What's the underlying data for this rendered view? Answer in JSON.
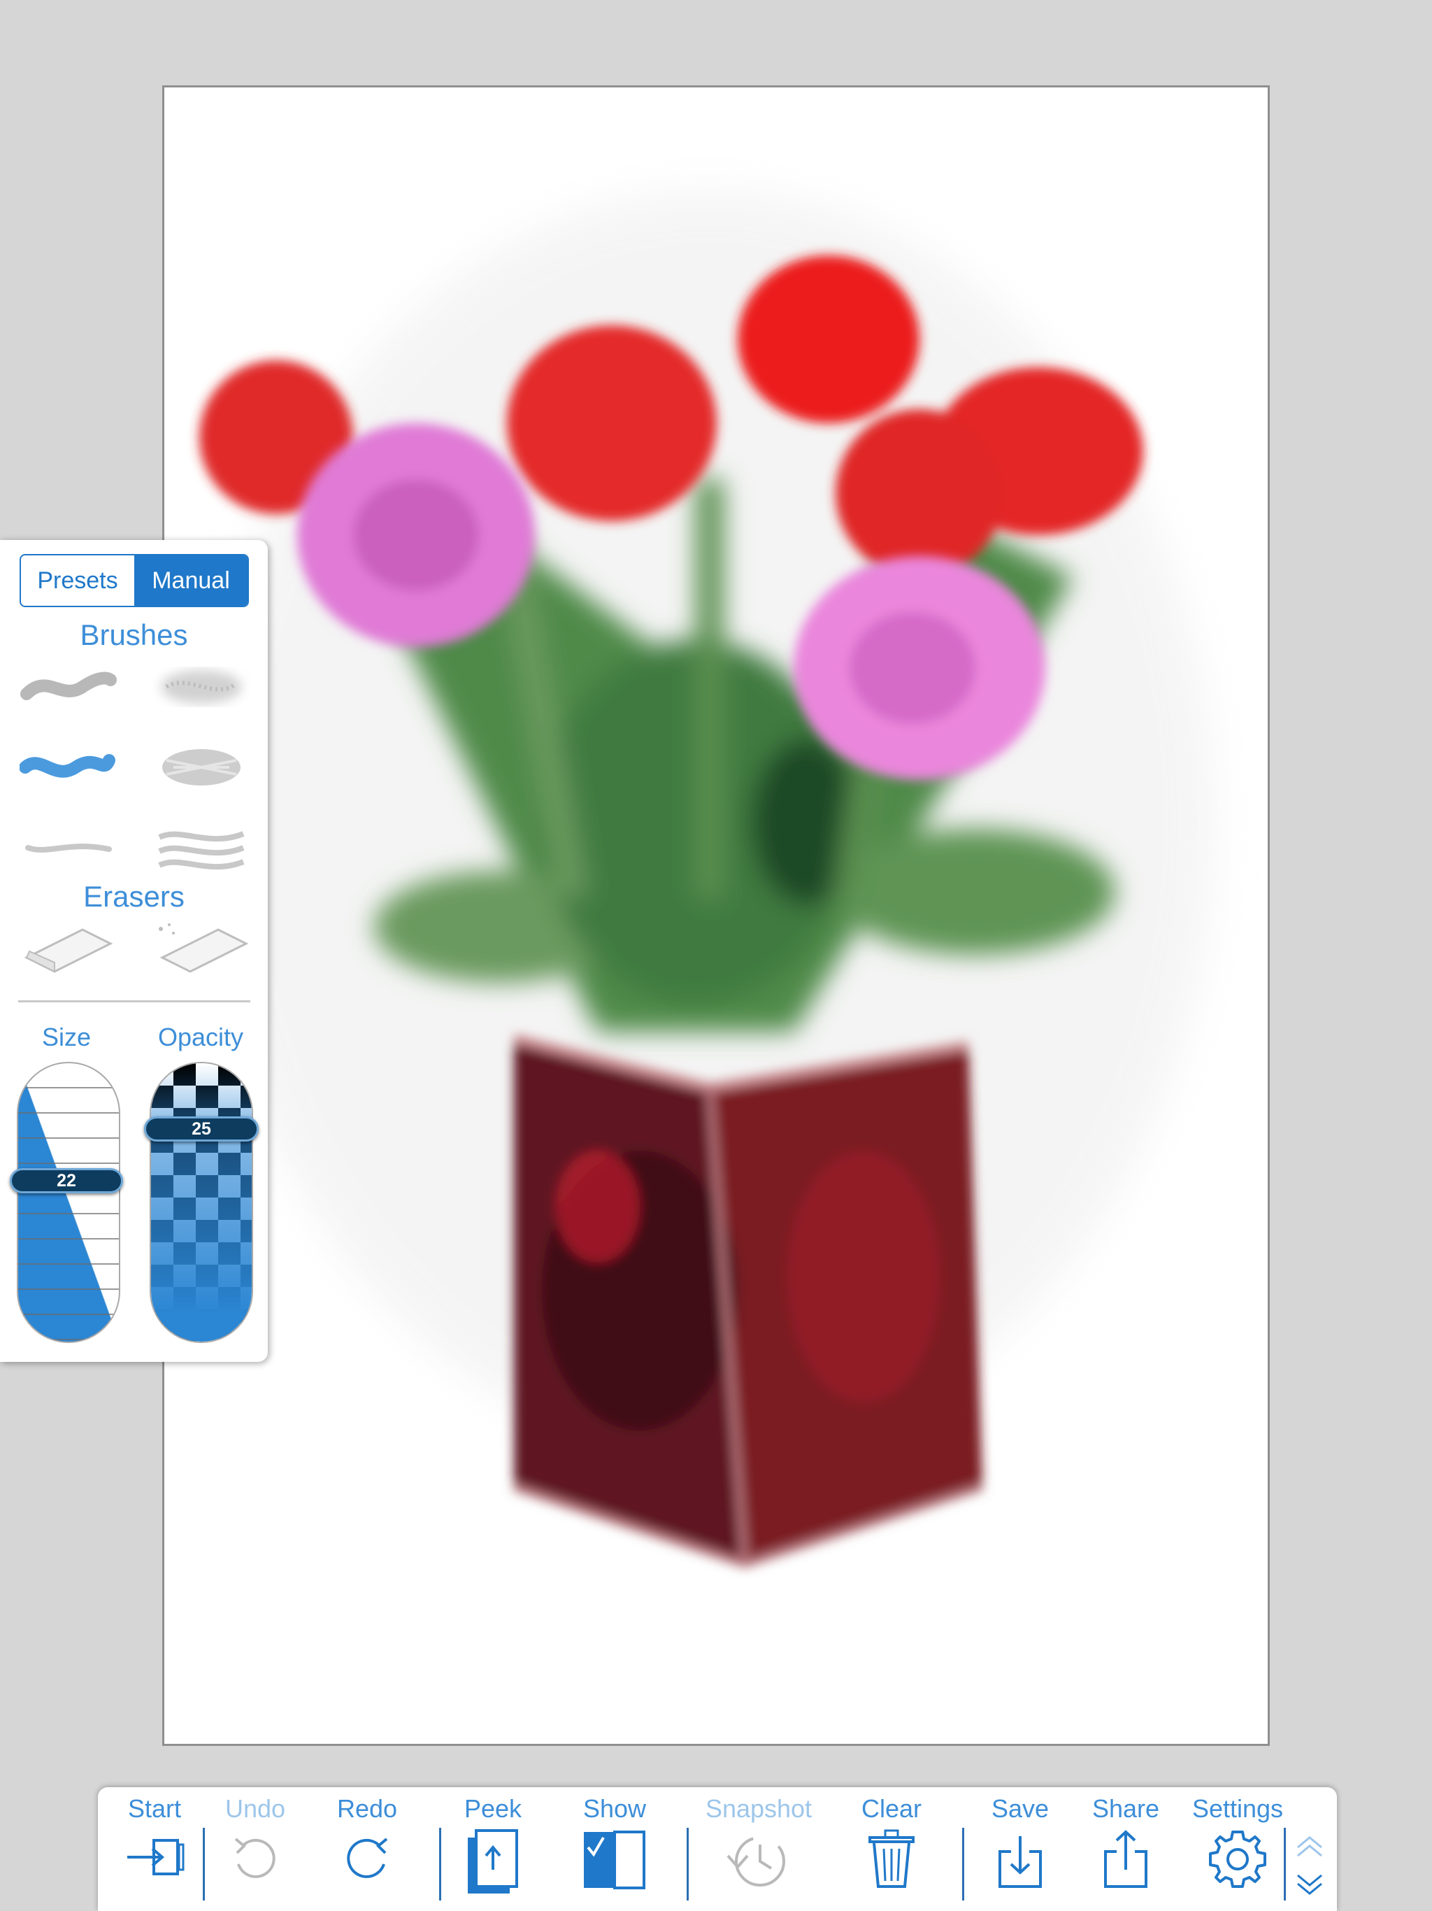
{
  "panel": {
    "segment_presets": "Presets",
    "segment_manual": "Manual",
    "brushes_title": "Brushes",
    "erasers_title": "Erasers",
    "size_label": "Size",
    "opacity_label": "Opacity",
    "size_value": "22",
    "opacity_value": "25"
  },
  "toolbar": {
    "start": "Start",
    "undo": "Undo",
    "redo": "Redo",
    "peek": "Peek",
    "show": "Show",
    "snapshot": "Snapshot",
    "clear": "Clear",
    "save": "Save",
    "share": "Share",
    "settings": "Settings"
  },
  "colors": {
    "accent": "#1f78c9",
    "label": "#3d8ed8",
    "background": "#d6d6d6"
  },
  "icons": [
    "start-icon",
    "undo-icon",
    "redo-icon",
    "peek-icon",
    "show-icon",
    "snapshot-icon",
    "clear-icon",
    "save-icon",
    "share-icon",
    "settings-icon",
    "chevron-up-icon",
    "chevron-down-icon"
  ]
}
